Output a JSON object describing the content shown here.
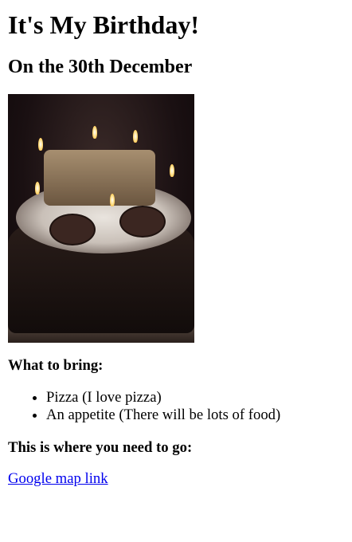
{
  "title": "It's My Birthday!",
  "subtitle": "On the 30th December",
  "image": {
    "alt": "Birthday cake with candles"
  },
  "bring": {
    "heading": "What to bring:",
    "items": [
      "Pizza (I love pizza)",
      "An appetite (There will be lots of food)"
    ]
  },
  "location": {
    "heading": "This is where you need to go:",
    "link_label": "Google map link"
  }
}
